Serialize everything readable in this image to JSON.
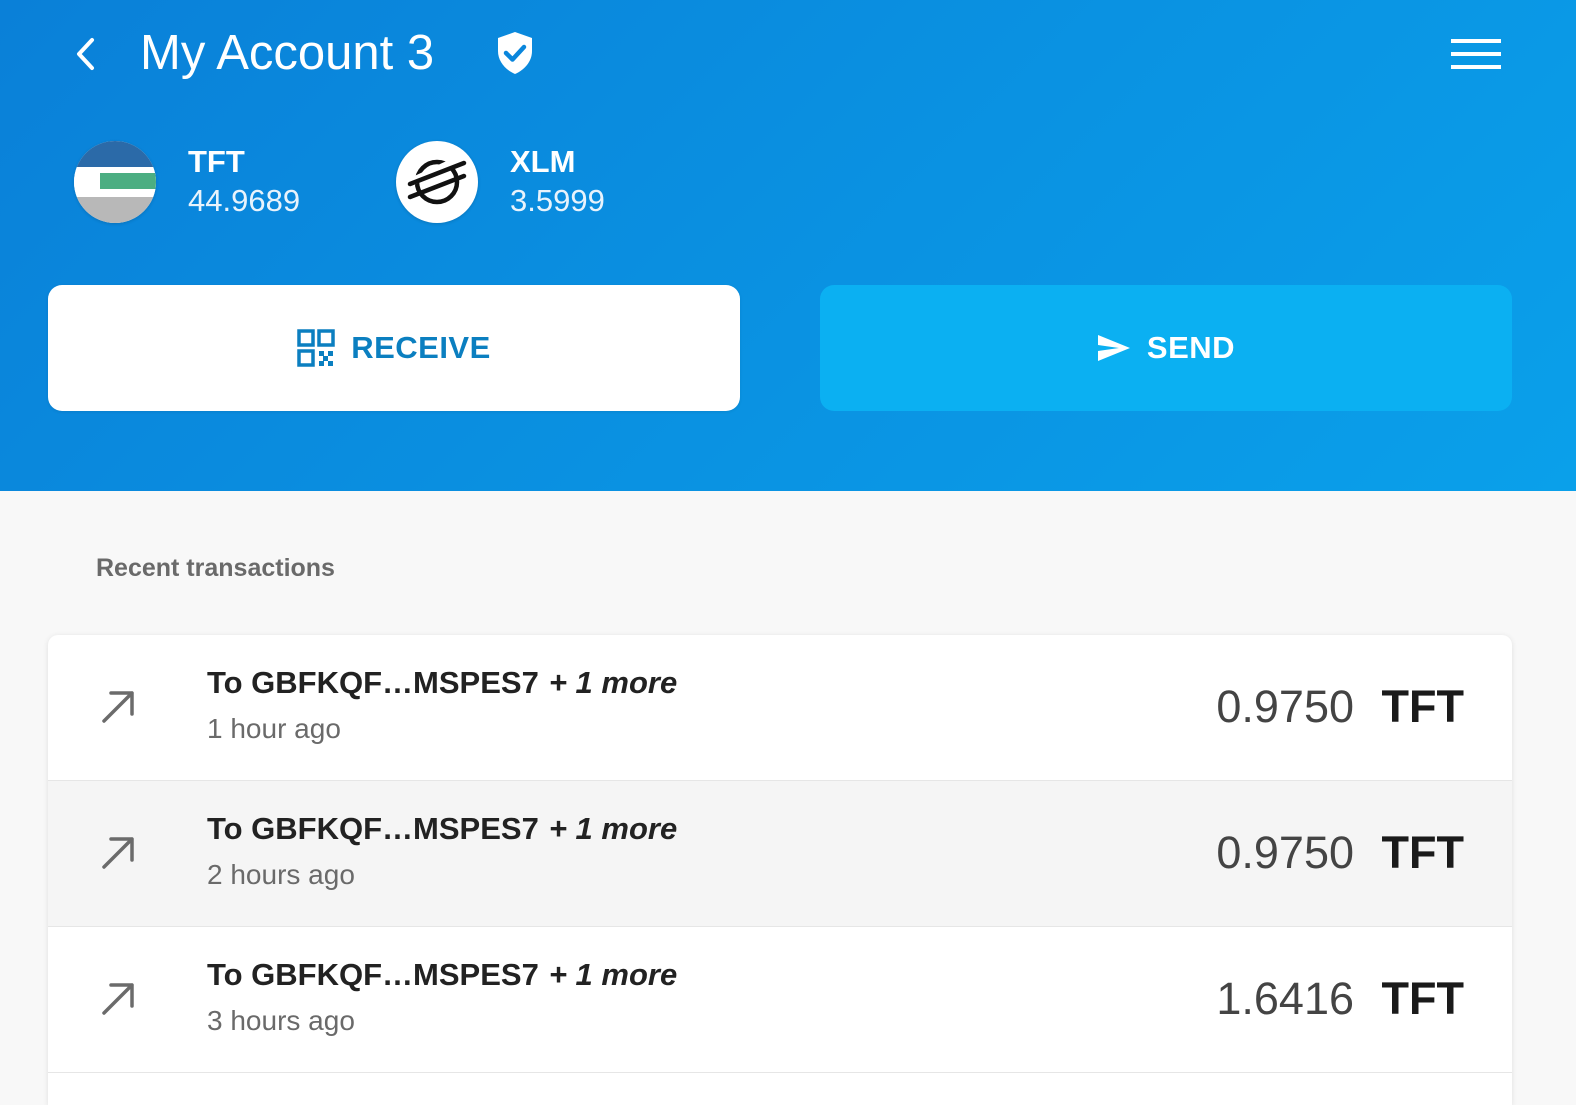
{
  "header": {
    "title": "My Account 3",
    "colors": {
      "gradient_start": "#0a80d8",
      "gradient_end": "#0aa0ea",
      "receive_text": "#0b7fc0",
      "send_bg": "#0bb0f2"
    },
    "icons": {
      "back": "chevron-left-icon",
      "verified": "verified-shield-icon",
      "menu": "hamburger-menu-icon"
    }
  },
  "assets": [
    {
      "code": "TFT",
      "balance": "44.9689",
      "icon": "tft-logo"
    },
    {
      "code": "XLM",
      "balance": "3.5999",
      "icon": "stellar-logo"
    }
  ],
  "actions": {
    "receive_label": "RECEIVE",
    "receive_icon": "qr-code-icon",
    "send_label": "SEND",
    "send_icon": "send-arrow-icon"
  },
  "transactions": {
    "section_title": "Recent transactions",
    "items": [
      {
        "to": "To GBFKQF…MSPES7",
        "more": "+ 1 more",
        "time": "1 hour ago",
        "amount": "0.9750",
        "asset": "TFT",
        "direction": "outgoing"
      },
      {
        "to": "To GBFKQF…MSPES7",
        "more": "+ 1 more",
        "time": "2 hours ago",
        "amount": "0.9750",
        "asset": "TFT",
        "direction": "outgoing"
      },
      {
        "to": "To GBFKQF…MSPES7",
        "more": "+ 1 more",
        "time": "3 hours ago",
        "amount": "1.6416",
        "asset": "TFT",
        "direction": "outgoing"
      }
    ]
  }
}
